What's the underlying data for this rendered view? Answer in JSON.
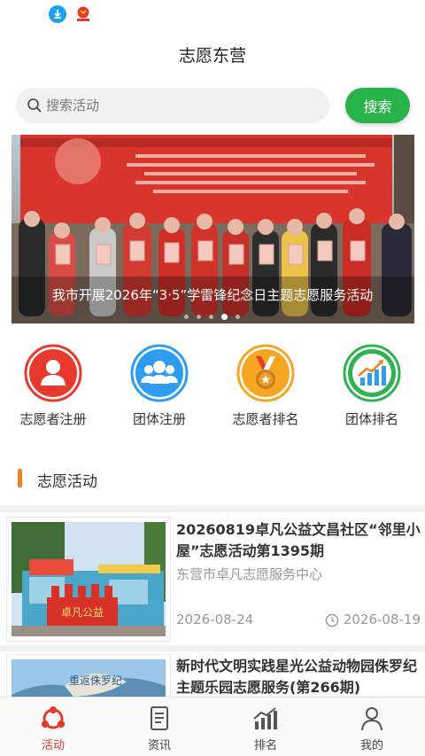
{
  "header": {
    "title": "志愿东营"
  },
  "search": {
    "placeholder": "搜索活动",
    "button_label": "搜索"
  },
  "banner": {
    "caption": "我市开展2026年“3·5”学雷锋纪念日主题志愿服务活动",
    "slide_count": 5,
    "active_slide": 4
  },
  "quick_links": [
    {
      "label": "志愿者注册",
      "icon": "person-icon",
      "color": "#e8392d"
    },
    {
      "label": "团体注册",
      "icon": "group-icon",
      "color": "#2e9df0"
    },
    {
      "label": "志愿者排名",
      "icon": "medal-icon",
      "color": "#f6a623"
    },
    {
      "label": "团体排名",
      "icon": "chart-trend-icon",
      "color": "#2fb352"
    }
  ],
  "section": {
    "title": "志愿活动"
  },
  "activities": [
    {
      "title": "20260819卓凡公益文昌社区“邻里小屋”志愿活动第1395期",
      "org": "东营市卓凡志愿服务中心",
      "date": "2026-08-24",
      "end_date": "2026-08-19"
    },
    {
      "title": "新时代文明实践星光公益动物园侏罗纪主题乐园志愿服务(第266期)"
    }
  ],
  "tabbar": [
    {
      "label": "活动",
      "active": true
    },
    {
      "label": "资讯",
      "active": false
    },
    {
      "label": "排名",
      "active": false
    },
    {
      "label": "我的",
      "active": false
    }
  ],
  "colors": {
    "accent_green": "#27b34a",
    "accent_red": "#e8392d",
    "section_orange": "#f08126"
  }
}
